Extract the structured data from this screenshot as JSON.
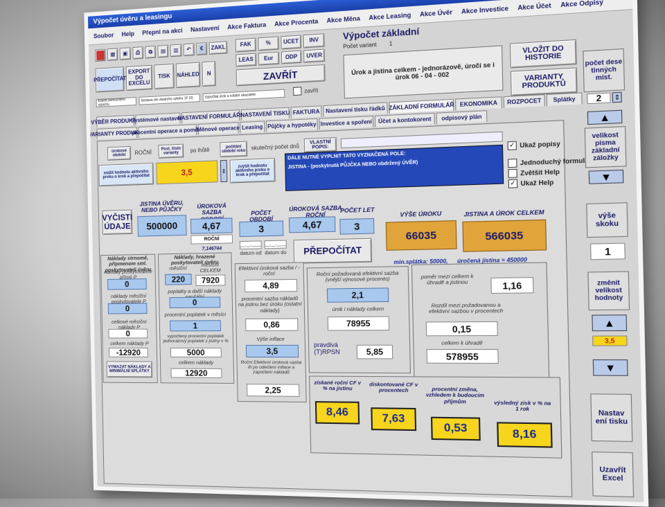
{
  "window": {
    "title": "Výpočet úvěru a leasingu"
  },
  "menu": [
    "Soubor",
    "Help",
    "Přepni na akci",
    "Nastavení",
    "Akce Faktura",
    "Akce Procenta",
    "Akce Měna",
    "Akce Leasing",
    "Akce Úvěr",
    "Akce Investice",
    "Akce Účet",
    "Akce Odpisy"
  ],
  "toolbar": {
    "zakl": "ZAKL",
    "prepocitat": "PŘEPOČÍTAT",
    "export": "EXPORT DO EXCELU",
    "tisk": "TISK",
    "nahled": "NÁHLED",
    "n": "N",
    "combo1": "Export pomocného výpočtu",
    "combo2": "Sestava dle vlastního výběru 1F (0)",
    "combo3": "Vypočítej úrok a ostatní ukazatele"
  },
  "quick": [
    "FAK",
    "%",
    "UCET",
    "INV",
    "LEAS",
    "Eur",
    "ODP",
    "UVER"
  ],
  "zavrit": "ZAVŘÍT",
  "zavrit_chk": "zavřít",
  "calc": {
    "title": "Výpočet základní",
    "variants_label": "Počet variant",
    "variants_value": "1"
  },
  "desc": "Úrok a jistina celkem - jednorázově, úročí se i úrok 06 - 04 - 002",
  "right_top": {
    "vlozit": "VLOŽIT DO HISTORIE",
    "varianty": "VARIANTY PRODUKTŮ",
    "pocet_des": "počet dese tinných míst.",
    "pocet_val": "2"
  },
  "tabs1": [
    "VÝBĚR PRODUKTU",
    "Systémové nastavení",
    "NASTAVENÍ FORMULÁŘE",
    "NASTAVENÍ TISKU",
    "FAKTURA",
    "Nastavení tisku řádků",
    "ZÁKLADNÍ FORMULÁŘ",
    "EKONOMIKA",
    "ROZPOCET",
    "Splátky"
  ],
  "tabs2": [
    "VARIANTY PRODUKTŮ",
    "procentní operace a poměry",
    "Měnové operace",
    "Leasing",
    "Půjčky a hypotéky",
    "Investice a spoření",
    "Účet a kontokorent",
    "odpisový plán"
  ],
  "row3": {
    "urok_obdobi": "úrokové období",
    "rocni": "ROČNÍ",
    "posl_cislo": "Posl. číslo varianty",
    "po_jistite": "po lhůtě",
    "pocitani": "počítání období roku",
    "skutecny": "skutečný počet dnů",
    "vlastni": "VLASTNÍ POPIS:"
  },
  "hint_btn1": "snížit hodnotu aktivního prvku o krok a přepočítat",
  "hint_btn2": "zvýšit hodnotu aktivního prvku o krok a přepočítat",
  "active_value": "3,5",
  "info_lines": [
    "DÁLE NUTNÉ VYPLNIT TATO VYZNAČENÁ POLE:",
    "JISTINA - (poskytnutá PŮJČKA NEBO obdržený ÚVĚR)"
  ],
  "checks": {
    "ukaz_popisy": "Ukaž popisy",
    "jednoduchy": "Jednoduchý formulář",
    "zvetsit": "Zvětšit Help",
    "ukaz_help": "Ukaž Help"
  },
  "main": {
    "vycisti": "VYČISTI ÚDAJE",
    "jistina_lbl": "JISTINA ÚVĚRU, NEBO PŮJČKY",
    "jistina": "500000",
    "sazba_lbl": "ÚROKOVÁ SAZBA OBDOBÍ",
    "sazba": "4,67",
    "sazba_unit": "ROČNÍ",
    "sazba_sub": "7,146744",
    "pocet_obd_lbl": "POČET OBDOBÍ",
    "pocet_obd": "3",
    "sazba_rocni_lbl": "ÚROKOVÁ SAZBA ROČNÍ",
    "sazba_rocni": "4,67",
    "pocet_let_lbl": "POČET LET",
    "pocet_let": "3",
    "datum_od": "datum od",
    "datum_do": "datum do",
    "datum_placeholder": "__.__.____",
    "prepocitat": "PŘEPOČÍTAT",
    "vyse_uroku_lbl": "VÝŠE ÚROKU",
    "vyse_uroku": "66035",
    "jistina_urok_lbl": "JISTINA A ÚROK CELKEM",
    "jistina_urok": "566035",
    "min_splatka": "min.splátka: 50000,",
    "urocena": "úročená jistina = 450000"
  },
  "col1": {
    "title": "Náklady strnomě, přípmenom sml. poskytovateli úvěru",
    "l1": "náklady poskytovatele přímé P",
    "v1": "0",
    "l2": "náklady měsíční poskytovatele P",
    "v2": "0",
    "l3": "celkové měsíční náklady P",
    "v3": "0",
    "l4": "celkem náklady P",
    "v4": "-12920",
    "btn": "VYMAZAT NÁKLADY A MINIMÁLNÍ SPLÁTKY"
  },
  "col2": {
    "title": "Náklady, hrazené poskytovateli úvěru",
    "mesicni_lbl": "měsíční",
    "mesicni": "220",
    "mesicni_celkem_lbl": "měsíční CELKEM",
    "mesicni_celkem": "7920",
    "poplatky_lbl": "poplatky a další náklady paušální",
    "poplatky": "0",
    "procent_lbl": "procentní poplatek v měsíci",
    "procent": "1",
    "vypocteny_lbl": "vypočtený procentní poplatek jednorázový poplatek z jistiny v %",
    "vypocteny": "5000",
    "celkem_lbl": "celkem náklady",
    "celkem": "12920"
  },
  "col3": {
    "l1": "Efektivní úroková sazba / - roční",
    "v1": "4,89",
    "l2": "procentní sazba nákladů na jistinu bez úroku (ostatní náklady)",
    "v2": "0,86",
    "l3": "Výše inflace",
    "v3": "3,5",
    "l4": "Roční Efektivní úroková sazba III po odečtení inflace a započtení nákladů",
    "v4": "2,25"
  },
  "col4": {
    "l1": "Roční požadovaná efektivní sazba (vnější výnosové procento)",
    "v1": "2,1",
    "l2": "úrok i náklady celkem",
    "v2": "78955",
    "rpsn_lbl": "pravdivá (T)RPSN",
    "rpsn": "5,85"
  },
  "col5": {
    "l1": "poměr mezi celkem k úhradě a jistinou",
    "v1": "1,16",
    "l2": "Rozdíl mezi požadovanou a efektivní sazbou v procentech",
    "v2": "0,15",
    "l3": "celkem k úhradě",
    "v3": "578955"
  },
  "bottom": [
    {
      "label": "získané roční CF v % na jistinu",
      "value": "8,46"
    },
    {
      "label": "diskontované CF v procentech",
      "value": "7,63"
    },
    {
      "label": "procentní změna, vzhledem k budoucím příjmům",
      "value": "0,53"
    },
    {
      "label": "výsledný zisk v % na 1 rok",
      "value": "8,16"
    }
  ],
  "side": {
    "velikost_pisma": "velikost písma základní záložky",
    "vyse_skoku": "výše skoku",
    "vyse_skoku_val": "1",
    "zmenit": "změnit velikost hodnoty",
    "krok_val": "3,5",
    "nastaveni_tisku": "Nastav ení tisku",
    "uzavrit_excel": "Uzavřít Excel"
  }
}
